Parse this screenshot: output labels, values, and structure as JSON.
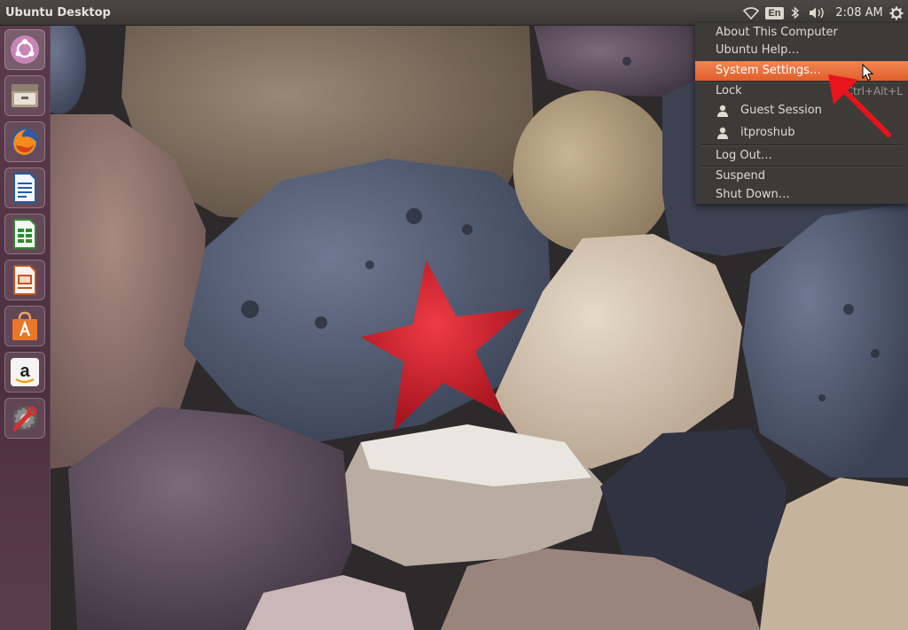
{
  "panel": {
    "title": "Ubuntu Desktop",
    "language_indicator": "En",
    "clock": "2:08 AM",
    "icons": [
      "wifi-icon",
      "bluetooth-icon",
      "volume-icon",
      "gear-icon"
    ]
  },
  "launcher": {
    "items": [
      {
        "name": "dash-home",
        "icon": "ubuntu-logo-icon"
      },
      {
        "name": "files",
        "icon": "file-manager-icon"
      },
      {
        "name": "firefox",
        "icon": "firefox-icon"
      },
      {
        "name": "writer",
        "icon": "libreoffice-writer-icon"
      },
      {
        "name": "calc",
        "icon": "libreoffice-calc-icon"
      },
      {
        "name": "impress",
        "icon": "libreoffice-impress-icon"
      },
      {
        "name": "software-center",
        "icon": "software-center-icon"
      },
      {
        "name": "amazon",
        "icon": "amazon-icon"
      },
      {
        "name": "system-settings",
        "icon": "settings-wrench-icon"
      }
    ]
  },
  "session_menu": {
    "about": "About This Computer",
    "help": "Ubuntu Help…",
    "settings": "System Settings…",
    "lock": "Lock",
    "lock_shortcut": "Ctrl+Alt+L",
    "guest": "Guest Session",
    "user": "itproshub",
    "logout": "Log Out…",
    "suspend": "Suspend",
    "shutdown": "Shut Down…"
  },
  "colors": {
    "highlight": "#e95420",
    "annotation_arrow": "#e8141b",
    "starfish": "#d3202b"
  }
}
